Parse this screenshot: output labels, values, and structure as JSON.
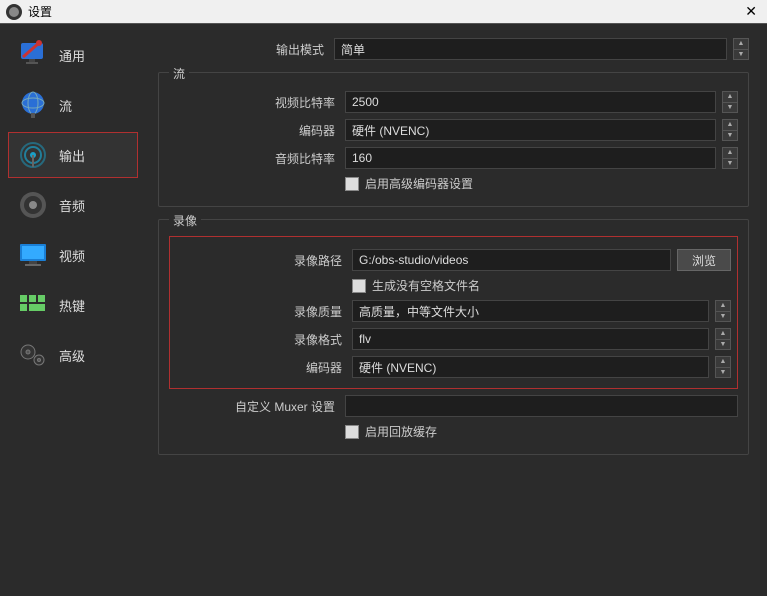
{
  "window": {
    "title": "设置"
  },
  "sidebar": {
    "items": [
      {
        "label": "通用"
      },
      {
        "label": "流"
      },
      {
        "label": "输出"
      },
      {
        "label": "音频"
      },
      {
        "label": "视频"
      },
      {
        "label": "热键"
      },
      {
        "label": "高级"
      }
    ]
  },
  "output_mode": {
    "label": "输出模式",
    "value": "简单"
  },
  "stream": {
    "legend": "流",
    "video_bitrate": {
      "label": "视频比特率",
      "value": "2500"
    },
    "encoder": {
      "label": "编码器",
      "value": "硬件 (NVENC)"
    },
    "audio_bitrate": {
      "label": "音频比特率",
      "value": "160"
    },
    "advanced_checkbox": {
      "label": "启用高级编码器设置"
    }
  },
  "recording": {
    "legend": "录像",
    "path": {
      "label": "录像路径",
      "value": "G:/obs-studio/videos",
      "browse": "浏览"
    },
    "no_space_checkbox": {
      "label": "生成没有空格文件名"
    },
    "quality": {
      "label": "录像质量",
      "value": "高质量，中等文件大小"
    },
    "format": {
      "label": "录像格式",
      "value": "flv"
    },
    "encoder": {
      "label": "编码器",
      "value": "硬件 (NVENC)"
    },
    "muxer": {
      "label": "自定义 Muxer 设置",
      "value": ""
    },
    "replay_checkbox": {
      "label": "启用回放缓存"
    }
  }
}
